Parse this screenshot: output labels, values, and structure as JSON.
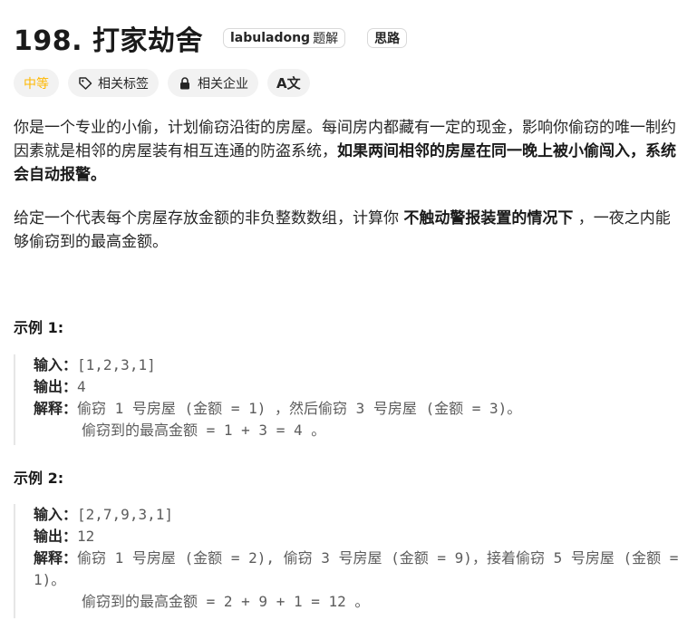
{
  "title": "198. 打家劫舍",
  "title_tags": {
    "labuladong": "labuladong",
    "labuladong_sub": "题解",
    "silu": "思路"
  },
  "pills": {
    "difficulty": "中等",
    "related_tags": "相关标签",
    "related_companies": "相关企业",
    "lang_toggle": "A文"
  },
  "description": {
    "p1_a": "你是一个专业的小偷，计划偷窃沿街的房屋。每间房内都藏有一定的现金，影响你偷窃的唯一制约因素就是相邻的房屋装有相互连通的防盗系统，",
    "p1_bold": "如果两间相邻的房屋在同一晚上被小偷闯入，系统会自动报警。",
    "p2_a": "给定一个代表每个房屋存放金额的非负整数数组，计算你 ",
    "p2_bold": "不触动警报装置的情况下",
    "p2_b": " ，一夜之内能够偷窃到的最高金额。"
  },
  "examples": [
    {
      "title": "示例 1:",
      "input_label": "输入：",
      "input": "[1,2,3,1]",
      "output_label": "输出：",
      "output": "4",
      "explain_label": "解释：",
      "explain_1": "偷窃 1 号房屋 (金额 = 1) ，然后偷窃 3 号房屋 (金额 = 3)。",
      "explain_2": "偷窃到的最高金额 = 1 + 3 = 4 。"
    },
    {
      "title": "示例 2:",
      "input_label": "输入：",
      "input": "[2,7,9,3,1]",
      "output_label": "输出：",
      "output": "12",
      "explain_label": "解释：",
      "explain_1": "偷窃 1 号房屋 (金额 = 2), 偷窃 3 号房屋 (金额 = 9)，接着偷窃 5 号房屋 (金额 = 1)。",
      "explain_2": "偷窃到的最高金额 = 2 + 9 + 1 = 12 。"
    }
  ],
  "colors": {
    "difficulty": "#ffb800",
    "pill_bg": "#f2f2f2",
    "text": "#262626"
  },
  "icons": [
    "tag-icon",
    "lock-icon",
    "translate-icon"
  ]
}
